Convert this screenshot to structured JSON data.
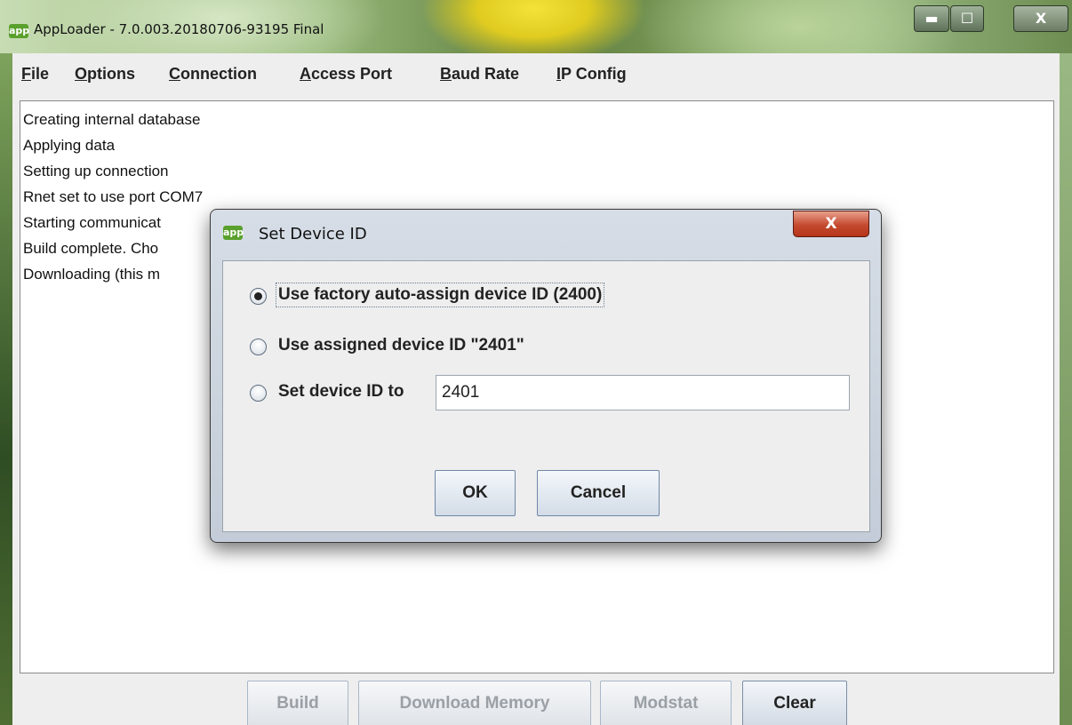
{
  "window": {
    "icon_text": "app",
    "title": "AppLoader - 7.0.003.20180706-93195 Final",
    "min_glyph": "▬",
    "max_glyph": "☐",
    "close_glyph": "X"
  },
  "menu": {
    "items": [
      {
        "accel": "F",
        "rest": "ile"
      },
      {
        "accel": "O",
        "rest": "ptions"
      },
      {
        "accel": "C",
        "rest": "onnection"
      },
      {
        "accel": "A",
        "rest": "ccess Port"
      },
      {
        "accel": "B",
        "rest": "aud Rate"
      },
      {
        "accel": "I",
        "rest": "P Config"
      }
    ]
  },
  "log": {
    "lines": [
      "Creating internal database",
      "Applying data",
      "Setting up connection",
      "Rnet set to use port COM7",
      "Starting communicat",
      "Build complete.  Cho",
      "Downloading (this m"
    ]
  },
  "buttons": {
    "build": "Build",
    "download_memory": "Download Memory",
    "modstat": "Modstat",
    "clear": "Clear"
  },
  "dialog": {
    "icon_text": "app",
    "title": "Set Device ID",
    "close_glyph": "X",
    "options": [
      {
        "label": "Use factory auto-assign device ID  (2400)",
        "checked": true
      },
      {
        "label": "Use assigned device ID \"2401\"",
        "checked": false
      },
      {
        "label": "Set device ID to",
        "checked": false
      }
    ],
    "device_id_value": "2401",
    "ok": "OK",
    "cancel": "Cancel"
  }
}
